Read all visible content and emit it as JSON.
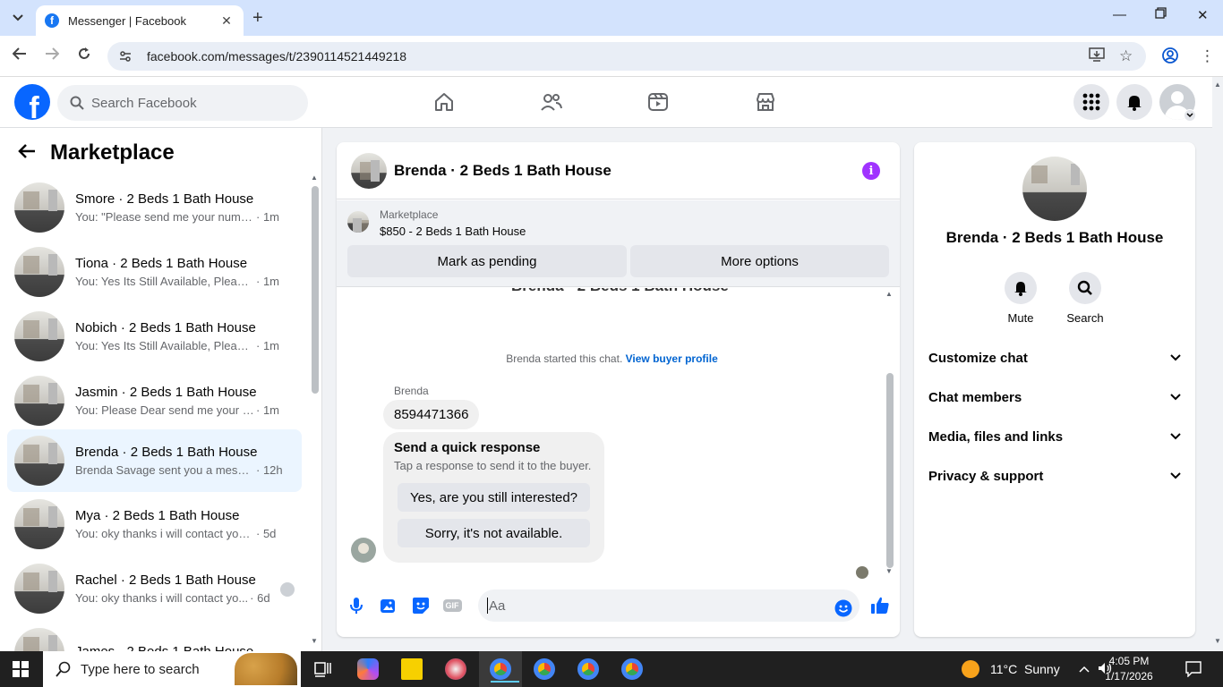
{
  "browser": {
    "tab_title": "Messenger | Facebook",
    "url": "facebook.com/messages/t/2390114521449218"
  },
  "fb": {
    "search_placeholder": "Search Facebook",
    "logo_letter": "f"
  },
  "left": {
    "title": "Marketplace",
    "conversations": [
      {
        "name": "Smore · 2 Beds 1 Bath House",
        "preview": "You: \"Please send me your number...",
        "time": "· 1m"
      },
      {
        "name": "Tiona · 2 Beds 1 Bath House",
        "preview": "You: Yes Its Still Available, Please S...",
        "time": "· 1m"
      },
      {
        "name": "Nobich · 2 Beds 1 Bath House",
        "preview": "You: Yes Its Still Available, Please S...",
        "time": "· 1m"
      },
      {
        "name": "Jasmin · 2 Beds 1 Bath House",
        "preview": "You: Please Dear send me your nu...",
        "time": "· 1m"
      },
      {
        "name": "Brenda · 2 Beds 1 Bath House",
        "preview": "Brenda Savage sent you a messag...",
        "time": "· 12h"
      },
      {
        "name": "Mya · 2 Beds 1 Bath House",
        "preview": "You: oky thanks i will contact you s...",
        "time": "· 5d"
      },
      {
        "name": "Rachel · 2 Beds 1 Bath House",
        "preview": "You: oky thanks i will contact yo...",
        "time": "· 6d"
      },
      {
        "name": "James · 2 Beds 1 Bath House",
        "preview": "",
        "time": ""
      }
    ]
  },
  "chat": {
    "title": "Brenda · 2 Beds 1 Bath House",
    "marketplace_label": "Marketplace",
    "listing": "$850 - 2 Beds 1 Bath House",
    "mark_pending": "Mark as pending",
    "more_options": "More options",
    "started_text": "Brenda started this chat.",
    "view_profile": "View buyer profile",
    "sender": "Brenda",
    "message": "8594471366",
    "quick_title": "Send a quick response",
    "quick_sub": "Tap a response to send it to the buyer.",
    "quick_1": "Yes, are you still interested?",
    "quick_2": "Sorry, it's not available.",
    "input_placeholder": "Aa",
    "gif_label": "GIF"
  },
  "right": {
    "name": "Brenda · 2 Beds 1 Bath House",
    "mute": "Mute",
    "search": "Search",
    "sections": [
      "Customize chat",
      "Chat members",
      "Media, files and links",
      "Privacy & support"
    ]
  },
  "taskbar": {
    "search_placeholder": "Type here to search",
    "weather": "11°C  Sunny",
    "time": "4:05 PM",
    "date": "1/17/2026"
  },
  "colors": {
    "fb_blue": "#0866ff",
    "accent_purple": "#a033ff",
    "link_blue": "#0064d1"
  }
}
